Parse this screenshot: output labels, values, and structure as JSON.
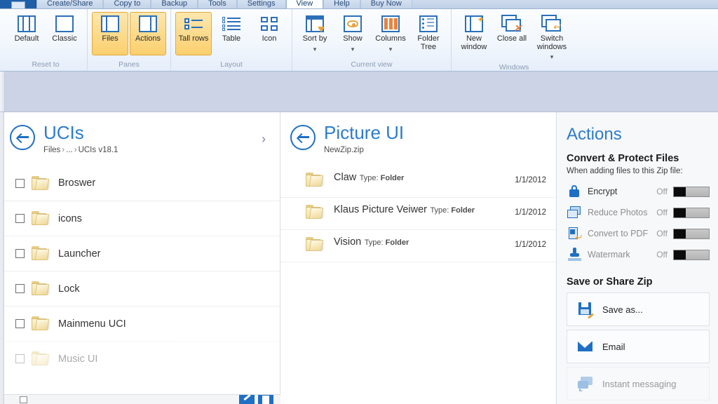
{
  "window": {
    "tabs": [
      {
        "label": "Create/Share",
        "active": false
      },
      {
        "label": "Copy to",
        "active": false
      },
      {
        "label": "Backup",
        "active": false
      },
      {
        "label": "Tools",
        "active": false
      },
      {
        "label": "Settings",
        "active": false
      },
      {
        "label": "View",
        "active": true
      },
      {
        "label": "Help",
        "active": false
      },
      {
        "label": "Buy Now",
        "active": false
      }
    ]
  },
  "ribbon": {
    "groups": [
      {
        "label": "Reset to",
        "buttons": [
          {
            "name": "default",
            "label": "Default",
            "icon": "panes-three-icon",
            "active": false,
            "caret": false
          },
          {
            "name": "classic",
            "label": "Classic",
            "icon": "panes-one-icon",
            "active": false,
            "caret": false
          }
        ]
      },
      {
        "label": "Panes",
        "buttons": [
          {
            "name": "files",
            "label": "Files",
            "icon": "pane-left-icon",
            "active": true,
            "caret": false
          },
          {
            "name": "actions",
            "label": "Actions",
            "icon": "pane-right-icon",
            "active": true,
            "caret": false
          }
        ]
      },
      {
        "label": "Layout",
        "buttons": [
          {
            "name": "tall-rows",
            "label": "Tall rows",
            "icon": "tall-rows-icon",
            "active": true,
            "caret": false
          },
          {
            "name": "table",
            "label": "Table",
            "icon": "table-icon",
            "active": false,
            "caret": false
          },
          {
            "name": "icon",
            "label": "Icon",
            "icon": "icon-view-icon",
            "active": false,
            "caret": false
          }
        ]
      },
      {
        "label": "Current view",
        "buttons": [
          {
            "name": "sort-by",
            "label": "Sort by",
            "icon": "sort-by-icon",
            "active": false,
            "caret": true
          },
          {
            "name": "show",
            "label": "Show",
            "icon": "eye-icon",
            "active": false,
            "caret": true
          },
          {
            "name": "columns",
            "label": "Columns",
            "icon": "columns-icon",
            "active": false,
            "caret": true
          },
          {
            "name": "folder-tree",
            "label": "Folder Tree",
            "icon": "folder-tree-icon",
            "active": false,
            "caret": false
          }
        ]
      },
      {
        "label": "Windows",
        "buttons": [
          {
            "name": "new-window",
            "label": "New window",
            "icon": "new-window-icon",
            "active": false,
            "caret": false
          },
          {
            "name": "close-all",
            "label": "Close all",
            "icon": "close-all-icon",
            "active": false,
            "caret": false
          },
          {
            "name": "switch-windows",
            "label": "Switch windows",
            "icon": "switch-windows-icon",
            "active": false,
            "caret": true
          }
        ]
      }
    ]
  },
  "files_panel": {
    "title": "UCIs",
    "breadcrumb_root": "Files",
    "breadcrumb_ellipsis": "...",
    "breadcrumb_current": "UCIs v18.1",
    "expand_icon": "chevron-right-icon",
    "back_icon": "back-arrow-icon",
    "items": [
      {
        "name": "Broswer",
        "faded": false
      },
      {
        "name": "icons",
        "faded": false
      },
      {
        "name": "Launcher",
        "faded": false
      },
      {
        "name": "Lock",
        "faded": false
      },
      {
        "name": "Mainmenu UCI",
        "faded": false
      },
      {
        "name": "Music UI",
        "faded": true
      }
    ]
  },
  "zip_panel": {
    "title": "Picture UI",
    "subtitle": "NewZip.zip",
    "back_icon": "back-arrow-icon",
    "type_label": "Type:",
    "items": [
      {
        "name": "Claw",
        "type": "Folder",
        "date": "1/1/2012"
      },
      {
        "name": "Klaus Picture Veiwer",
        "type": "Folder",
        "date": "1/1/2012"
      },
      {
        "name": "Vision",
        "type": "Folder",
        "date": "1/1/2012"
      }
    ]
  },
  "actions_panel": {
    "title": "Actions",
    "convert_section": {
      "heading": "Convert & Protect Files",
      "subheading": "When adding files to this Zip file:",
      "rows": [
        {
          "label": "Encrypt",
          "state": "Off",
          "icon": "lock-icon",
          "dim": false
        },
        {
          "label": "Reduce Photos",
          "state": "Off",
          "icon": "photos-icon",
          "dim": true
        },
        {
          "label": "Convert to PDF",
          "state": "Off",
          "icon": "pdf-icon",
          "dim": true
        },
        {
          "label": "Watermark",
          "state": "Off",
          "icon": "stamp-icon",
          "dim": true
        }
      ]
    },
    "share_section": {
      "heading": "Save or Share Zip",
      "buttons": [
        {
          "label": "Save as...",
          "icon": "save-disk-icon",
          "dim": false
        },
        {
          "label": "Email",
          "icon": "envelope-icon",
          "dim": false
        },
        {
          "label": "Instant messaging",
          "icon": "chat-bubbles-icon",
          "dim": true
        }
      ]
    }
  },
  "status": {
    "files_text": "",
    "zip_text": ""
  },
  "colors": {
    "accent_blue": "#2d7ccd",
    "ribbon_highlight": "#fbcf6d",
    "band": "#ccd3e6"
  }
}
